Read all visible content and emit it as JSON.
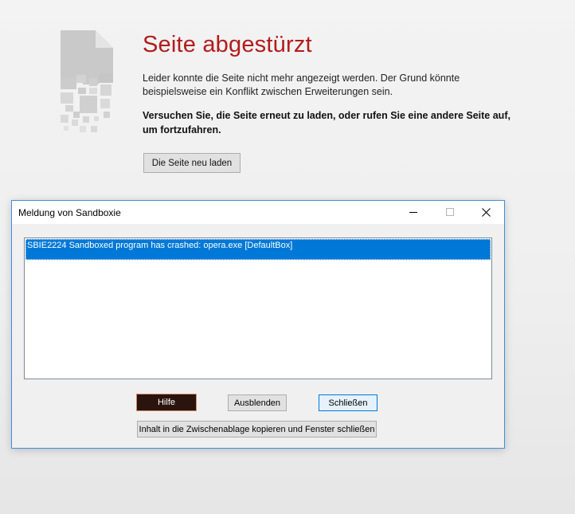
{
  "crash_page": {
    "title": "Seite abgestürzt",
    "description": "Leider konnte die Seite nicht mehr angezeigt werden. Der Grund könnte beispielsweise ein Konflikt zwischen Erweiterungen sein.",
    "hint": "Versuchen Sie, die Seite erneut zu laden, oder rufen Sie eine andere Seite auf, um fortzufahren.",
    "reload_label": "Die Seite neu laden",
    "icon": "crashed-page-icon",
    "title_color": "#b31b1b"
  },
  "dialog": {
    "title": "Meldung von Sandboxie",
    "messages": [
      "SBIE2224 Sandboxed program has crashed: opera.exe [DefaultBox]"
    ],
    "buttons": {
      "help": "Hilfe",
      "hide": "Ausblenden",
      "close": "Schließen",
      "copy_close": "Inhalt in die Zwischenablage kopieren und Fenster schließen"
    },
    "window_controls": [
      "minimize-icon",
      "maximize-icon",
      "close-icon"
    ],
    "selection_color": "#0078d7"
  }
}
